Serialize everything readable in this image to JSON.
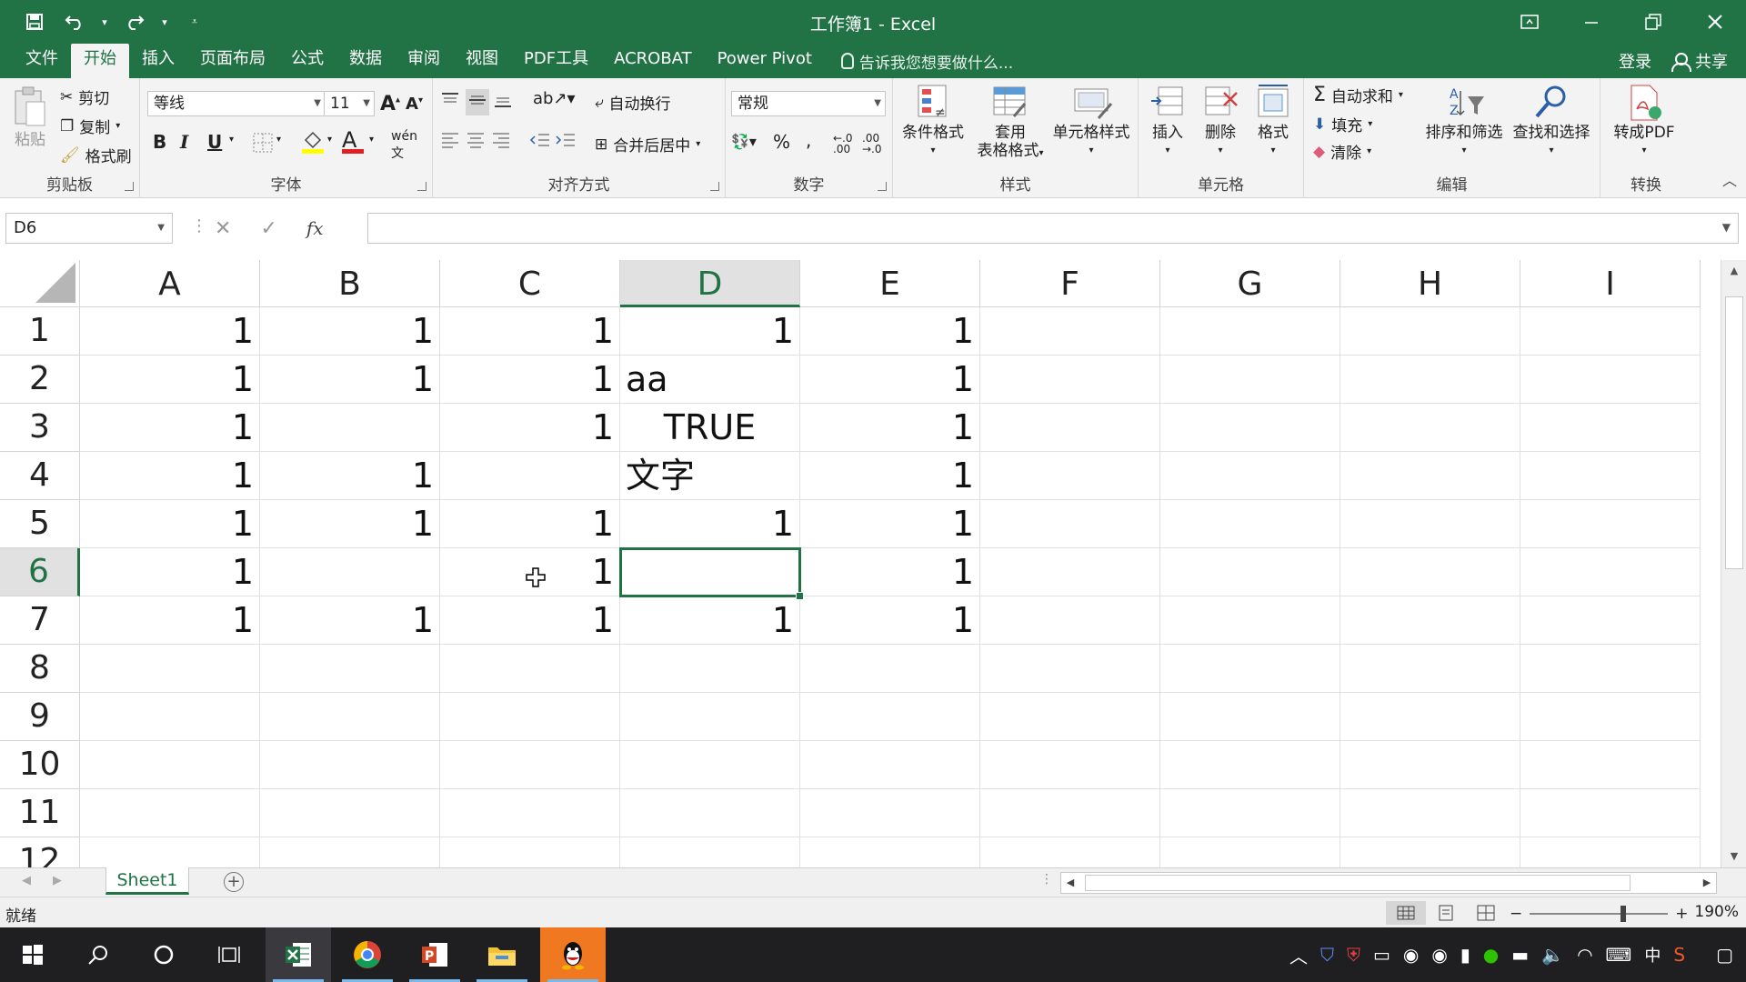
{
  "app": {
    "title": "工作簿1 - Excel",
    "accent": "#217346"
  },
  "tabs": [
    {
      "label": "文件"
    },
    {
      "label": "开始",
      "active": true
    },
    {
      "label": "插入"
    },
    {
      "label": "页面布局"
    },
    {
      "label": "公式"
    },
    {
      "label": "数据"
    },
    {
      "label": "审阅"
    },
    {
      "label": "视图"
    },
    {
      "label": "PDF工具"
    },
    {
      "label": "ACROBAT"
    },
    {
      "label": "Power Pivot"
    }
  ],
  "tellme": "告诉我您想要做什么...",
  "account": {
    "login": "登录",
    "share": "共享"
  },
  "ribbon": {
    "clipboard": {
      "label": "剪贴板",
      "paste": "粘贴",
      "cut": "剪切",
      "copy": "复制",
      "format_painter": "格式刷"
    },
    "font": {
      "label": "字体",
      "name": "等线",
      "size": "11",
      "bold": "B",
      "italic": "I",
      "underline": "U"
    },
    "alignment": {
      "label": "对齐方式",
      "wrap": "自动换行",
      "merge": "合并后居中"
    },
    "number": {
      "label": "数字",
      "format": "常规",
      "percent": "%",
      "comma": ","
    },
    "styles": {
      "label": "样式",
      "conditional": "条件格式",
      "table_format_1": "套用",
      "table_format_2": "表格格式",
      "cell_styles": "单元格样式"
    },
    "cells": {
      "label": "单元格",
      "insert": "插入",
      "delete": "删除",
      "format": "格式"
    },
    "editing": {
      "label": "编辑",
      "autosum": "自动求和",
      "fill": "填充",
      "clear": "清除",
      "sort": "排序和筛选",
      "find": "查找和选择"
    },
    "convert": {
      "label": "转换",
      "to_pdf": "转成PDF"
    }
  },
  "formula_bar": {
    "name_box": "D6",
    "fx": "fx",
    "value": ""
  },
  "sheet": {
    "columns": [
      "A",
      "B",
      "C",
      "D",
      "E",
      "F",
      "G",
      "H",
      "I"
    ],
    "selected_column": "D",
    "rows": [
      "1",
      "2",
      "3",
      "4",
      "5",
      "6",
      "7",
      "8",
      "9",
      "10",
      "11",
      "12"
    ],
    "selected_row": "6",
    "cells": [
      [
        "1",
        "1",
        "1",
        "1",
        "1"
      ],
      [
        "1",
        "1",
        "1",
        "aa",
        "1"
      ],
      [
        "1",
        "",
        "1",
        "TRUE",
        "1"
      ],
      [
        "1",
        "1",
        "",
        "文字",
        "1"
      ],
      [
        "1",
        "1",
        "1",
        "1",
        "1"
      ],
      [
        "1",
        "",
        "1",
        "",
        "1"
      ],
      [
        "1",
        "1",
        "1",
        "1",
        "1"
      ]
    ]
  },
  "sheet_tabs": [
    {
      "label": "Sheet1"
    }
  ],
  "status": {
    "ready": "就绪",
    "zoom": "190%"
  }
}
